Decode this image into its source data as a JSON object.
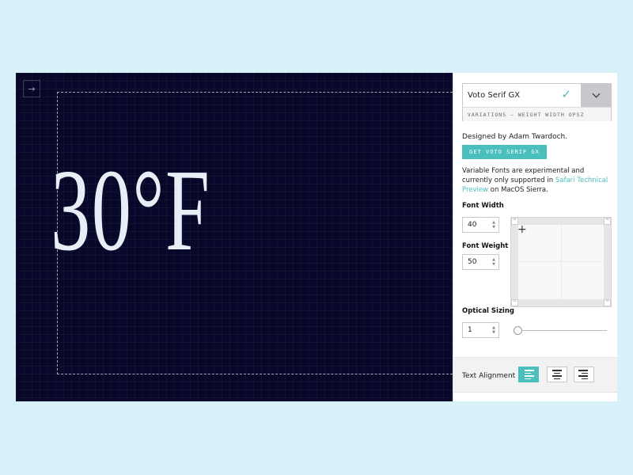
{
  "canvas": {
    "expand_icon": "→",
    "sample_text": "30°F"
  },
  "panel": {
    "font_selector": {
      "font_name": "Voto Serif GX",
      "variations": "VARIATIONS — WEIGHT WIDTH OPSZ"
    },
    "designer": "Designed by Adam Twardoch.",
    "get_button": "GET VOTO SERIF GX",
    "note": {
      "before": "Variable Fonts are experimental and currently only supported in ",
      "link": "Safari Technical Preview",
      "after": " on MacOS Sierra."
    },
    "font_width": {
      "label": "Font Width",
      "value": "40"
    },
    "font_weight": {
      "label": "Font Weight",
      "value": "50"
    },
    "optical_sizing": {
      "label": "Optical Sizing",
      "value": "1"
    },
    "text_alignment": {
      "label": "Text Alignment",
      "selected": "left"
    }
  },
  "colors": {
    "accent": "#4bbfbd",
    "canvas_bg": "#07072a",
    "page_bg": "#d8f1f8"
  }
}
